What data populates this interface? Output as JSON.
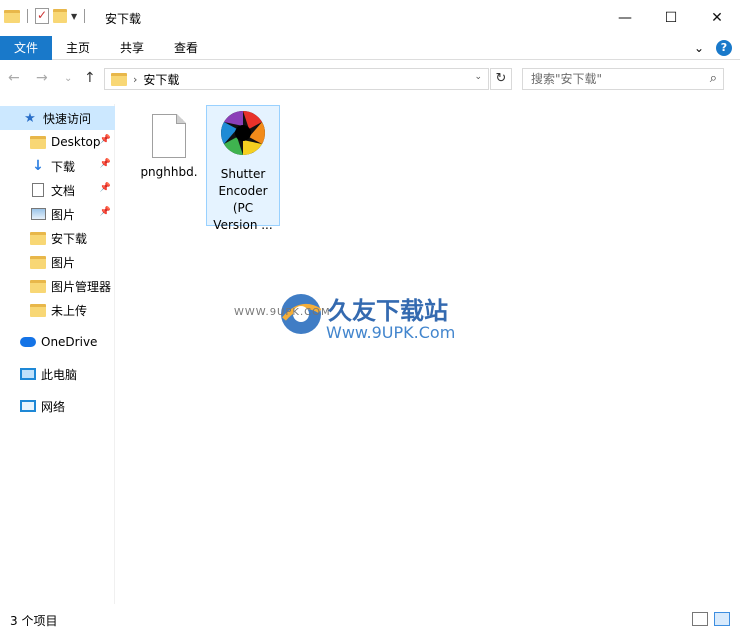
{
  "window": {
    "title": "安下载",
    "controls": {
      "minimize": "—",
      "maximize": "☐",
      "close": "✕"
    }
  },
  "ribbon": {
    "file_tab": "文件",
    "tabs": [
      "主页",
      "共享",
      "查看"
    ],
    "expand": "⌄",
    "help": "?"
  },
  "nav": {
    "back": "←",
    "forward": "→",
    "recent": "⌄",
    "up": "↑",
    "breadcrumb": [
      "安下载"
    ],
    "refresh": "↻",
    "search_placeholder": "搜索\"安下载\""
  },
  "sidebar": {
    "quick_access": "快速访问",
    "items": [
      {
        "label": "Desktop",
        "icon": "folder-icon",
        "pinned": true
      },
      {
        "label": "下载",
        "icon": "download-icon",
        "pinned": true
      },
      {
        "label": "文档",
        "icon": "document-icon",
        "pinned": true
      },
      {
        "label": "图片",
        "icon": "pictures-icon",
        "pinned": true
      },
      {
        "label": "安下载",
        "icon": "folder-icon",
        "pinned": false
      },
      {
        "label": "图片",
        "icon": "folder-icon",
        "pinned": false
      },
      {
        "label": "图片管理器",
        "icon": "folder-icon",
        "pinned": false
      },
      {
        "label": "未上传",
        "icon": "folder-icon",
        "pinned": false
      }
    ],
    "onedrive": "OneDrive",
    "this_pc": "此电脑",
    "network": "网络"
  },
  "files": [
    {
      "name": "pnghhbd.",
      "type": "file"
    },
    {
      "name_lines": [
        "Shutter",
        "Encoder",
        "(PC",
        "Version ..."
      ],
      "type": "application"
    }
  ],
  "watermark": {
    "title": "久友下载站",
    "url": "Www.9UPK.Com",
    "small": "WWW.9UPK.COM"
  },
  "status": {
    "item_count": "3 个项目"
  }
}
